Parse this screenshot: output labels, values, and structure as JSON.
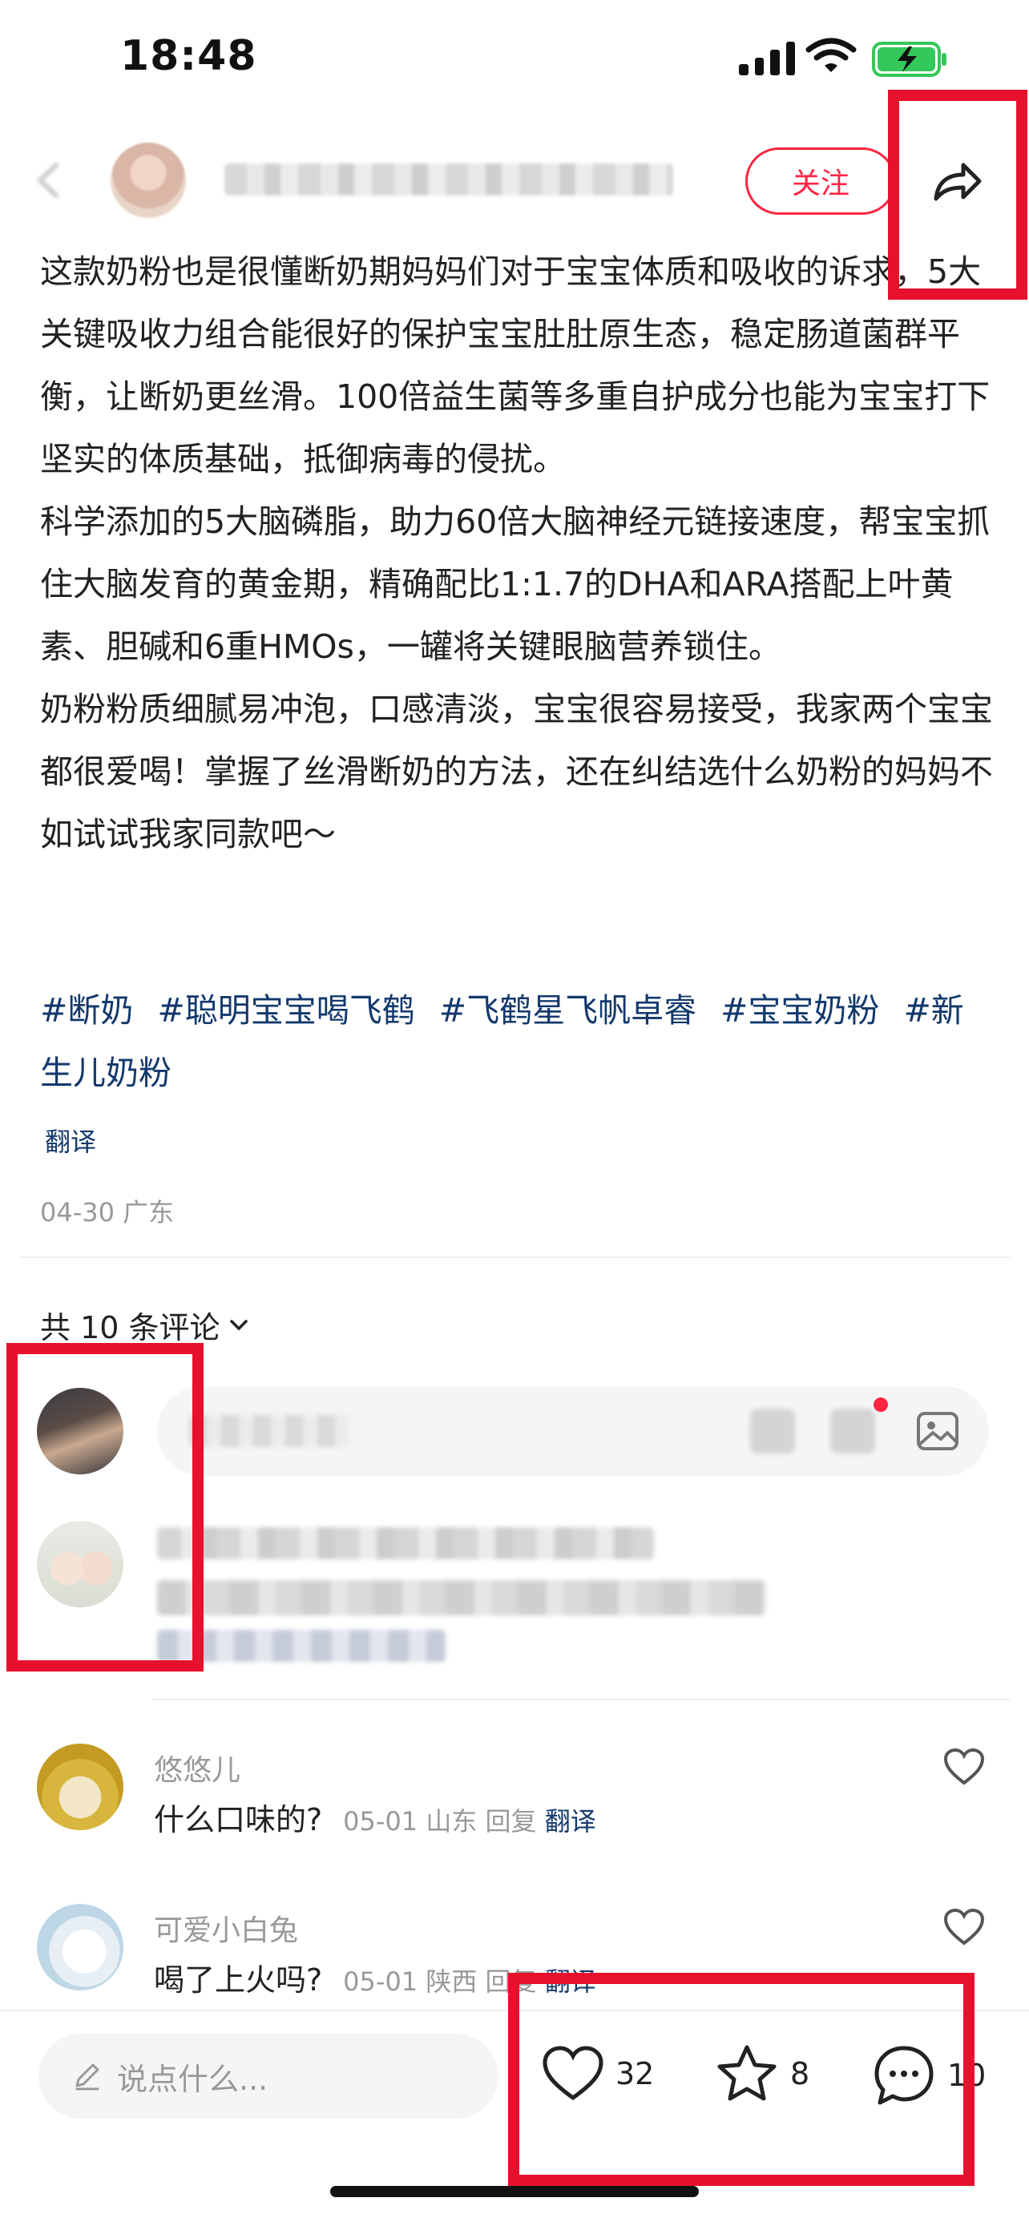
{
  "status_bar": {
    "time": "18:48"
  },
  "header": {
    "follow_label": "关注"
  },
  "post": {
    "paragraphs": [
      "这款奶粉也是很懂断奶期妈妈们对于宝宝体质和吸收的诉求，5大关键吸收力组合能很好的保护宝宝肚肚原生态，稳定肠道菌群平衡，让断奶更丝滑。100倍益生菌等多重自护成分也能为宝宝打下坚实的体质基础，抵御病毒的侵扰。",
      "科学添加的5大脑磷脂，助力60倍大脑神经元链接速度，帮宝宝抓住大脑发育的黄金期，精确配比1:1.7的DHA和ARA搭配上叶黄素、胆碱和6重HMOs，一罐将关键眼脑营养锁住。",
      "奶粉粉质细腻易冲泡，口感清淡，宝宝很容易接受，我家两个宝宝都很爱喝！掌握了丝滑断奶的方法，还在纠结选什么奶粉的妈妈不如试试我家同款吧～"
    ],
    "tags": [
      "#断奶",
      "#聪明宝宝喝飞鹤",
      "#飞鹤星飞帆卓睿",
      "#宝宝奶粉",
      "#新生儿奶粉"
    ],
    "translate_label": "翻译",
    "meta": "04-30 广东"
  },
  "comments": {
    "count_label": "共 10 条评论",
    "items": [
      {
        "name": "悠悠儿",
        "text": "什么口味的?",
        "meta": "05-01 山东",
        "reply": "回复",
        "translate": "翻译"
      },
      {
        "name": "可爱小白兔",
        "text": "喝了上火吗?",
        "meta": "05-01 陕西",
        "reply": "回复",
        "translate": "翻译"
      }
    ]
  },
  "bottom_bar": {
    "input_placeholder": "说点什么...",
    "likes": "32",
    "favorites": "8",
    "comments": "10"
  },
  "colors": {
    "accent": "#ff2442",
    "link": "#13386c",
    "annotation_red": "#e8112d"
  }
}
